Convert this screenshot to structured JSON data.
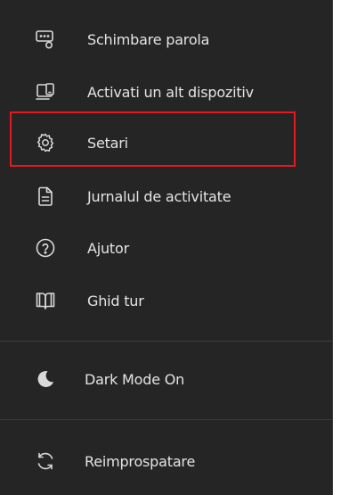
{
  "menu": {
    "items": [
      {
        "id": "schimbare-parola",
        "label": "Schimbare parola",
        "icon": "password-device-icon"
      },
      {
        "id": "activati-dispozitiv",
        "label": "Activati un alt dispozitiv",
        "icon": "devices-icon"
      },
      {
        "id": "setari",
        "label": "Setari",
        "icon": "gear-icon"
      },
      {
        "id": "jurnal",
        "label": "Jurnalul de activitate",
        "icon": "document-icon"
      },
      {
        "id": "ajutor",
        "label": "Ajutor",
        "icon": "help-icon"
      },
      {
        "id": "ghid-tur",
        "label": "Ghid tur",
        "icon": "book-icon"
      },
      {
        "id": "dark-mode",
        "label": "Dark Mode On",
        "icon": "moon-icon"
      },
      {
        "id": "reimprospatare",
        "label": "Reimprospatare",
        "icon": "refresh-icon"
      }
    ],
    "highlighted_item": "Setari"
  },
  "colors": {
    "background": "#252525",
    "text": "#e4e4e4",
    "icon": "#d9d9d9",
    "highlight_border": "#e5171f",
    "divider": "#3d3d3d"
  }
}
